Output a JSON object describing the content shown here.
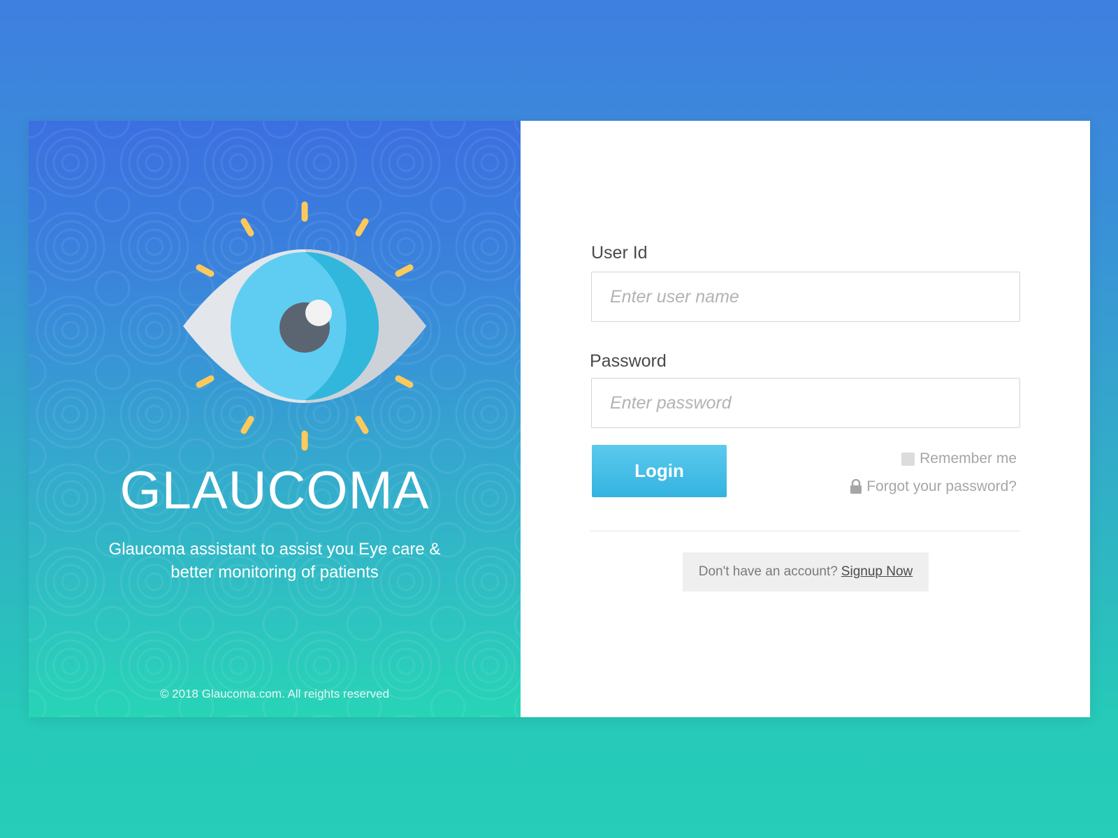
{
  "hero": {
    "title": "GLAUCOMA",
    "subtitle": "Glaucoma assistant to assist you Eye care & better monitoring of patients",
    "copyright": "© 2018 Glaucoma.com. All reights reserved",
    "logo_icon": "eye-icon"
  },
  "login_form": {
    "user_label": "User Id",
    "user_placeholder": "Enter user name",
    "user_value": "",
    "password_label": "Password",
    "password_placeholder": "Enter password",
    "password_value": "",
    "login_button": "Login",
    "remember_label": "Remember me",
    "remember_checked": false,
    "forgot_label": "Forgot your password?",
    "forgot_icon": "lock-icon",
    "signup_prompt": "Don't have an account?",
    "signup_link": "Signup Now"
  },
  "colors": {
    "login_button": "#3cbde6",
    "ray": "#fbc95c",
    "iris": "#5fcdf2",
    "pupil": "#5b6572"
  }
}
